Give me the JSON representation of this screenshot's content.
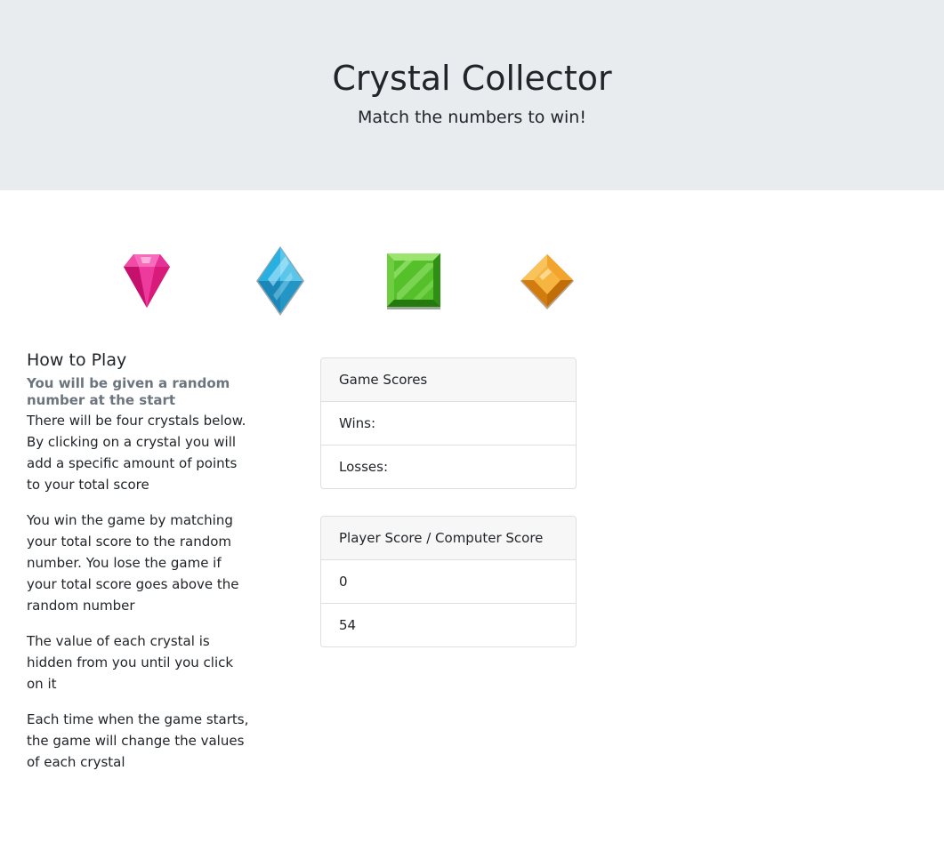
{
  "header": {
    "title": "Crystal Collector",
    "subtitle": "Match the numbers to win!"
  },
  "crystals": [
    {
      "name": "pink-crystal",
      "color": "#e91e8c"
    },
    {
      "name": "blue-crystal",
      "color": "#29a9d6"
    },
    {
      "name": "green-crystal",
      "color": "#4fc42a"
    },
    {
      "name": "orange-crystal",
      "color": "#f0a01c"
    }
  ],
  "instructions": {
    "heading": "How to Play",
    "subheading": "You will be given a random number at the start",
    "paragraphs": [
      "There will be four crystals below. By clicking on a crystal you will add a specific amount of points to your total score",
      "You win the game by matching your total score to the random number. You lose the game if your total score goes above the random number",
      "The value of each crystal is hidden from you until you click on it",
      "Each time when the game starts, the game will change the values of each crystal"
    ]
  },
  "game_scores": {
    "title": "Game Scores",
    "wins_label": "Wins:",
    "losses_label": "Losses:"
  },
  "score_panel": {
    "title": "Player Score / Computer Score",
    "player_score": "0",
    "computer_score": "54"
  }
}
